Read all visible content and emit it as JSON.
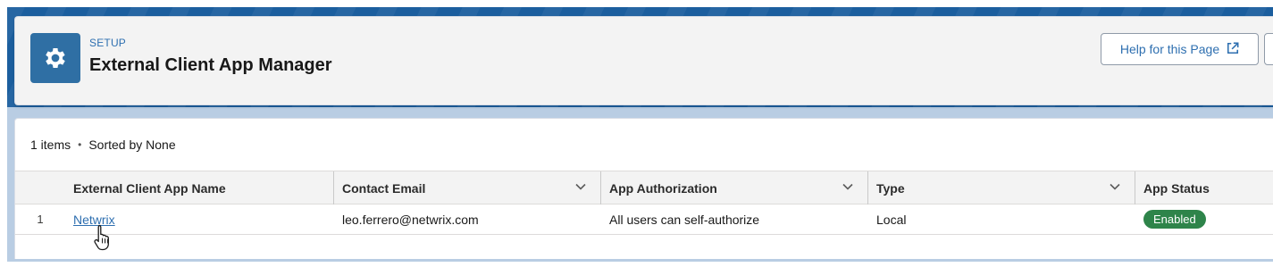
{
  "header": {
    "eyebrow": "SETUP",
    "title": "External Client App Manager",
    "help_label": "Help for this Page",
    "icons": {
      "setup": "gear-icon",
      "help": "external-link-icon"
    }
  },
  "list": {
    "count_text": "1 items",
    "separator": "•",
    "sort_text": "Sorted by None",
    "columns": [
      {
        "label": "External Client App Name"
      },
      {
        "label": "Contact Email"
      },
      {
        "label": "App Authorization"
      },
      {
        "label": "Type"
      },
      {
        "label": "App Status"
      }
    ],
    "rows": [
      {
        "index": "1",
        "name": "Netwrix",
        "email": "leo.ferrero@netwrix.com",
        "authorization": "All users can self-authorize",
        "type": "Local",
        "status": "Enabled"
      }
    ]
  },
  "colors": {
    "brand": "#2f6fa4",
    "link": "#2e6fb0",
    "status_enabled": "#2e844a"
  }
}
